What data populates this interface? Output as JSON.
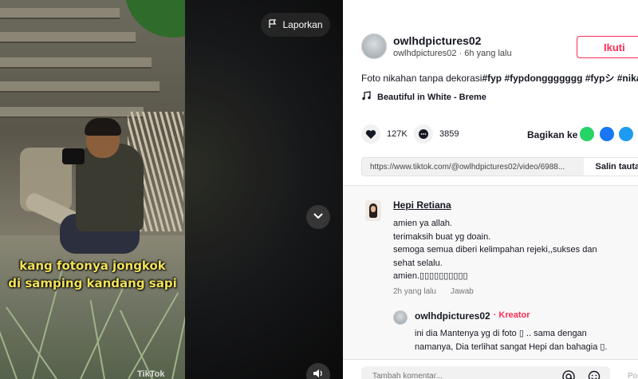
{
  "video": {
    "report_label": "Laporkan",
    "caption_line1": "kang fotonya jongkok",
    "caption_line2": "di samping kandang sapi",
    "watermark": "TikTok"
  },
  "post": {
    "username": "owlhdpictures02",
    "submeta": "owlhdpictures02 · 6h yang lalu",
    "follow_label": "Ikuti",
    "description_text": "Foto nikahan tanpa dekorasi",
    "hashtags": "#fyp #fypdonggggggg #fypシ #nika",
    "music": "Beautiful in White - Breme",
    "likes": "127K",
    "comments": "3859",
    "share_label": "Bagikan ke",
    "link": "https://www.tiktok.com/@owlhdpictures02/video/6988...",
    "copy_label": "Salin tautan"
  },
  "comment": {
    "author": "Hepi Retiana",
    "line1": "amien ya allah.",
    "line2": "terimaksih buat yg doain.",
    "line3": "semoga semua diberi kelimpahan rejeki,,sukses dan",
    "line4": "sehat selalu.",
    "line5": "amien.▯▯▯▯▯▯▯▯▯▯",
    "time": "2h yang lalu",
    "reply_label": "Jawab"
  },
  "reply": {
    "author": "owlhdpictures02",
    "badge": "· Kreator",
    "line1": "ini dia Mantenya yg di foto ▯ .. sama dengan",
    "line2": "namanya, Dia terlihat sangat Hepi dan bahagia ▯."
  },
  "input": {
    "placeholder": "Tambah komentar...",
    "post_label": "Posting"
  },
  "colors": {
    "accent": "#fe2c55",
    "caption": "#f3e35a",
    "whatsapp": "#25d366",
    "facebook": "#1877f2",
    "twitter": "#1d9bf0"
  }
}
